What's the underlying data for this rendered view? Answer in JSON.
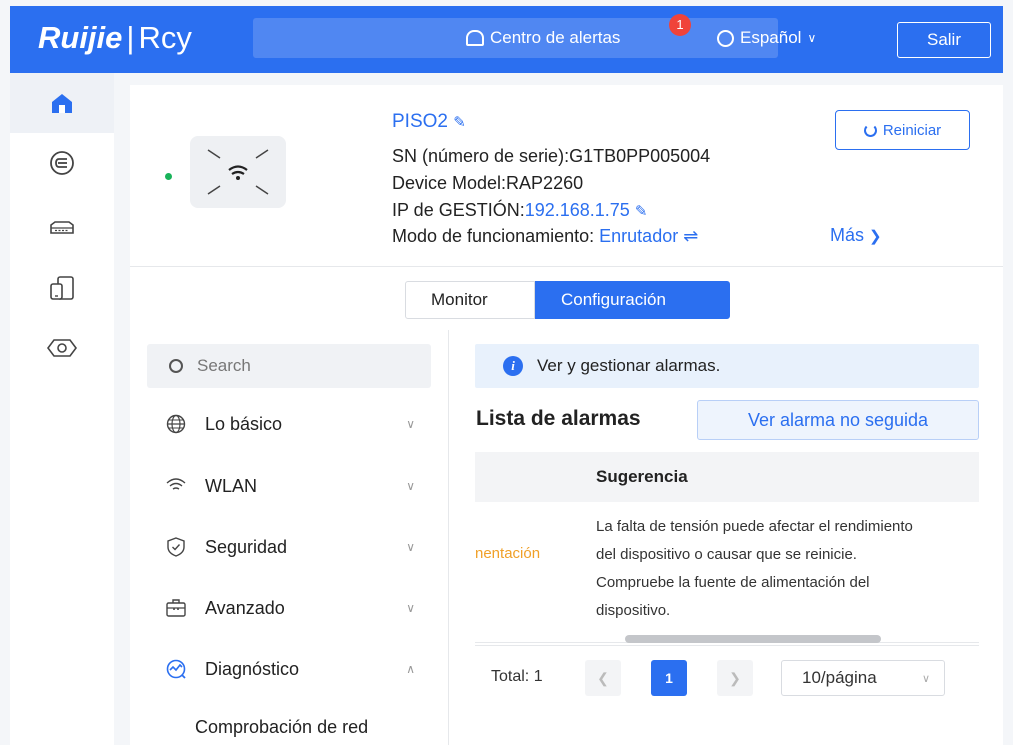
{
  "header": {
    "brand": "Ruijie",
    "brand_sub": "Rcy",
    "alerts_label": "Centro de alertas",
    "alerts_count": "1",
    "language": "Español",
    "logout_label": "Salir"
  },
  "leftnav": {
    "items": [
      {
        "icon": "home-icon",
        "active": true
      },
      {
        "icon": "router-icon",
        "active": false
      },
      {
        "icon": "switch-icon",
        "active": false
      },
      {
        "icon": "devices-icon",
        "active": false
      },
      {
        "icon": "gateway-icon",
        "active": false
      }
    ]
  },
  "device": {
    "name": "PISO2",
    "serial": "SN (número de serie):G1TB0PP005004",
    "model": "Device Model:RAP2260",
    "ip_label": "IP de GESTIÓN:",
    "ip_value": "192.168.1.75",
    "mode_label": "Modo de funcionamiento:",
    "mode_value": "Enrutador",
    "more_label": "Más",
    "reboot_label": "Reiniciar",
    "status_color": "#19b35a"
  },
  "tabs": {
    "monitor": "Monitor",
    "config": "Configuración"
  },
  "menu": {
    "search_placeholder": "Search",
    "items": [
      {
        "label": "Lo básico",
        "icon": "globe-icon"
      },
      {
        "label": "WLAN",
        "icon": "wifi-icon"
      },
      {
        "label": "Seguridad",
        "icon": "shield-icon"
      },
      {
        "label": "Avanzado",
        "icon": "toolbox-icon"
      },
      {
        "label": "Diagnóstico",
        "icon": "diagnostics-icon"
      }
    ],
    "sub_item": "Comprobación de red"
  },
  "alarms": {
    "info_text": "Ver y gestionar alarmas.",
    "list_title": "Lista de alarmas",
    "unfollowed_button": "Ver alarma no seguida",
    "column_suggestion": "Sugerencia",
    "row": {
      "type_fragment": "nentación",
      "suggestion": "La falta de tensión puede afectar el rendimiento del dispositivo o causar que se reinicie. Compruebe la fuente de alimentación del dispositivo."
    },
    "pagination": {
      "total": "Total: 1",
      "page": "1",
      "page_size": "10/página"
    }
  },
  "colors": {
    "primary": "#2b6ff0",
    "warning": "#f0a028",
    "badge": "#f0433a"
  }
}
